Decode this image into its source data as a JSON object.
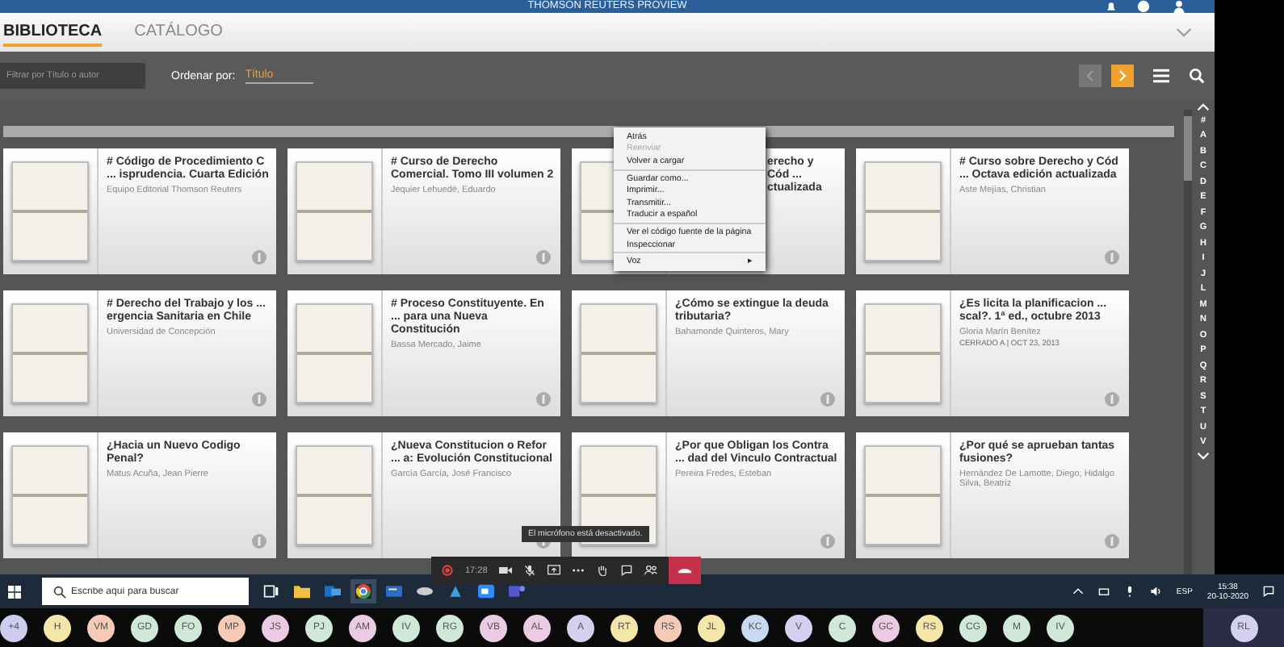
{
  "window": {
    "title": "THOMSON REUTERS PROVIEW"
  },
  "tabs": [
    {
      "label": "BIBLIOTECA",
      "selected": true
    },
    {
      "label": "CATÁLOGO",
      "selected": false
    }
  ],
  "toolbar": {
    "filter": {
      "placeholder": "Filtrar por Título o autor"
    },
    "sort_label": "Ordenar por:",
    "sort_value": "Título",
    "prev_disabled": true
  },
  "books": [
    {
      "kind": "full",
      "title": "# Código de Procedimiento C ... isprudencia. Cuarta Edición",
      "author": "Equipo Editorial Thomson Reuters"
    },
    {
      "kind": "full",
      "title": "# Curso de Derecho Comercial. Tomo III volumen 2",
      "author": "Jequier Lehuedé, Eduardo"
    },
    {
      "kind": "partial",
      "title": "erecho y Cód ... ctualizada"
    },
    {
      "kind": "full",
      "title": "# Curso sobre Derecho y Cód ... Octava edición actualizada",
      "author": "Aste Mejías, Christian"
    },
    {
      "kind": "full",
      "title": "# Derecho del Trabajo y los ... ergencia Sanitaria en Chile",
      "author": "Universidad de Concepción"
    },
    {
      "kind": "full",
      "title": "# Proceso Constituyente. En ... para una Nueva Constitución",
      "author": "Bassa Mercado, Jaime"
    },
    {
      "kind": "full",
      "title": "¿Cómo se extingue la deuda tributaria?",
      "author": "Bahamonde Quinteros, Mary"
    },
    {
      "kind": "full",
      "title": "¿Es licita la planificacion ... scal?. 1ª ed., octubre 2013",
      "author": "Gloria Marín Benítez",
      "note": "CERRADO A | OCT 23, 2013"
    },
    {
      "kind": "full",
      "title": "¿Hacia un Nuevo Codigo Penal?",
      "author": "Matus Acuña, Jean Pierre"
    },
    {
      "kind": "full",
      "title": "¿Nueva Constitucion o Refor ... a: Evolución Constitucional",
      "author": "García García, José Francisco"
    },
    {
      "kind": "full",
      "title": "¿Por que Obligan los Contra ... dad del Vinculo Contractual",
      "author": "Pereira Fredes, Esteban"
    },
    {
      "kind": "full",
      "title": "¿Por qué se aprueban tantas fusiones?",
      "author": "Hernández De Lamotte, Diego; Hidalgo Silva, Beatriz"
    }
  ],
  "alphabet": [
    "#",
    "A",
    "B",
    "C",
    "D",
    "E",
    "F",
    "G",
    "H",
    "I",
    "J",
    "L",
    "M",
    "N",
    "O",
    "P",
    "Q",
    "R",
    "S",
    "T",
    "U",
    "V"
  ],
  "context_menu": [
    {
      "label": "Atrás",
      "disabled": false,
      "separator_before": false
    },
    {
      "label": "Reenviar",
      "disabled": true,
      "separator_before": false
    },
    {
      "label": "Volver a cargar",
      "disabled": false,
      "separator_before": false
    },
    {
      "label": "Guardar como...",
      "disabled": false,
      "separator_before": true
    },
    {
      "label": "Imprimir...",
      "disabled": false,
      "separator_before": false
    },
    {
      "label": "Transmitir...",
      "disabled": false,
      "separator_before": false
    },
    {
      "label": "Traducir a español",
      "disabled": false,
      "separator_before": false
    },
    {
      "label": "Ver el código fuente de la página",
      "disabled": false,
      "separator_before": true
    },
    {
      "label": "Inspeccionar",
      "disabled": false,
      "separator_before": false
    },
    {
      "label": "Voz",
      "disabled": false,
      "separator_before": true,
      "submenu": "▸"
    }
  ],
  "call_bar": {
    "tooltip": "El micrófono está desactivado.",
    "duration": "17:28"
  },
  "taskbar": {
    "search": {
      "placeholder": "Escribe aquí para buscar"
    },
    "language": "ESP",
    "time": "15:38",
    "date": "20-10-2020"
  },
  "participants": [
    {
      "initials": "+4",
      "color": "#cfcdef"
    },
    {
      "initials": "H",
      "color": "#f3e6a8"
    },
    {
      "initials": "VM",
      "color": "#f5cbb8"
    },
    {
      "initials": "GD",
      "color": "#cfe8d8"
    },
    {
      "initials": "FO",
      "color": "#cfe8d8"
    },
    {
      "initials": "MP",
      "color": "#f5cbb8"
    },
    {
      "initials": "JS",
      "color": "#ebcbe3"
    },
    {
      "initials": "PJ",
      "color": "#cfe8d8"
    },
    {
      "initials": "AM",
      "color": "#ebcbe3"
    },
    {
      "initials": "IV",
      "color": "#cfe8d8"
    },
    {
      "initials": "RG",
      "color": "#cfe8d8"
    },
    {
      "initials": "VB",
      "color": "#ebcbe3"
    },
    {
      "initials": "AL",
      "color": "#ebcbe3"
    },
    {
      "initials": "A",
      "color": "#d3d0f0"
    },
    {
      "initials": "RT",
      "color": "#f3e6a8"
    },
    {
      "initials": "RS",
      "color": "#f5cbb8"
    },
    {
      "initials": "JL",
      "color": "#f3e6a8"
    },
    {
      "initials": "KC",
      "color": "#c9d9f1"
    },
    {
      "initials": "V",
      "color": "#d3d0f0"
    },
    {
      "initials": "C",
      "color": "#cfe8d8"
    },
    {
      "initials": "GC",
      "color": "#ebcbe3"
    },
    {
      "initials": "RS",
      "color": "#f3e6a8"
    },
    {
      "initials": "CG",
      "color": "#cfe8d8"
    },
    {
      "initials": "M",
      "color": "#cfe8d8"
    },
    {
      "initials": "IV",
      "color": "#cfe8d8"
    }
  ],
  "presenter": {
    "initials": "RL",
    "color": "#d3d0f0"
  }
}
